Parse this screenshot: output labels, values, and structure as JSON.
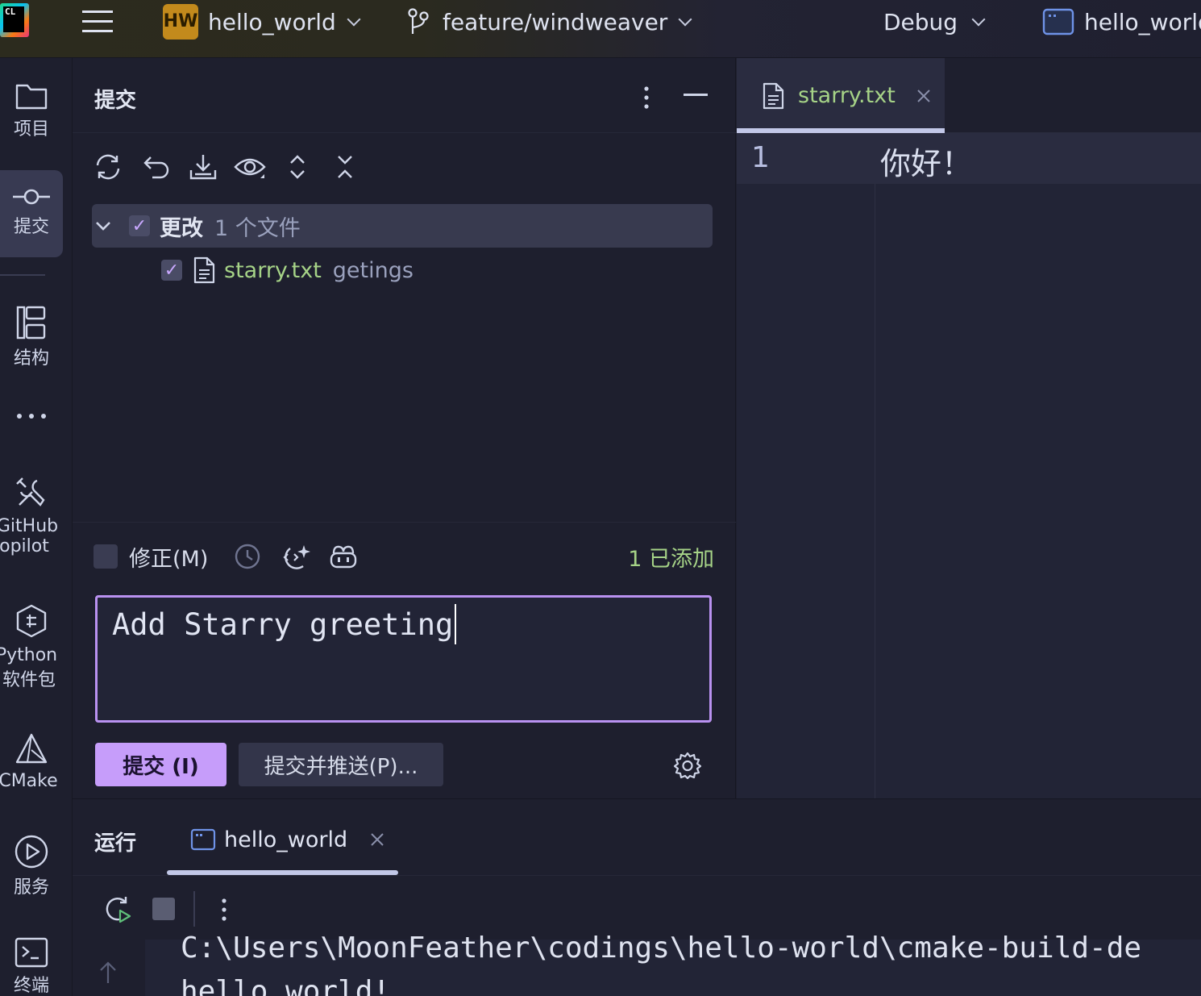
{
  "titlebar": {
    "app_logo_text": "CL",
    "project_badge": "HW",
    "project_name": "hello_world",
    "branch": "feature/windweaver",
    "build_config": "Debug",
    "run_target": "hello_world"
  },
  "stripe": {
    "items": [
      {
        "label": "项目"
      },
      {
        "label": "提交"
      },
      {
        "label": "结构"
      },
      {
        "label": "GitHub"
      },
      {
        "label": "opilot"
      },
      {
        "label": "Python"
      },
      {
        "label": "软件包"
      },
      {
        "label": "CMake"
      },
      {
        "label": "服务"
      },
      {
        "label": "终端"
      }
    ]
  },
  "commit": {
    "title": "提交",
    "group_label": "更改",
    "group_count": "1 个文件",
    "file_name": "starry.txt",
    "file_changelist": "getings",
    "amend_label": "修正(M)",
    "added_count": "1 已添加",
    "message": "Add Starry greeting",
    "commit_button": "提交 (I)",
    "commit_push_button": "提交并推送(P)..."
  },
  "editor": {
    "tab_name": "starry.txt",
    "line_number": "1",
    "line_text": "你好！"
  },
  "run": {
    "title": "运行",
    "tab_name": "hello_world",
    "console_line1": "C:\\Users\\MoonFeather\\codings\\hello-world\\cmake-build-de",
    "console_line2": "hello world!"
  },
  "colors": {
    "accent": "#c69dfa",
    "commit_border": "#b991f0",
    "added_green": "#a6d387",
    "background": "#1e1f2e"
  }
}
